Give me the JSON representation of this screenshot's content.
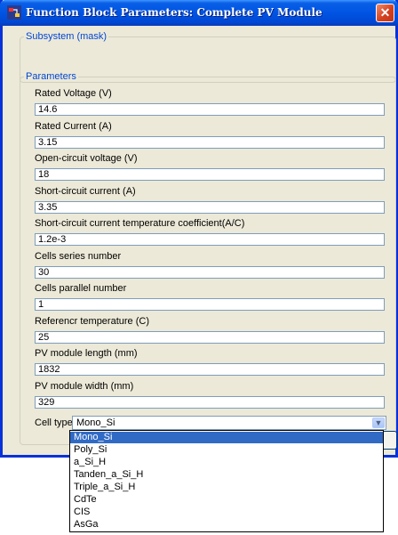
{
  "window": {
    "title": "Function Block Parameters: Complete PV Module",
    "close_glyph": "✕"
  },
  "mask_group": {
    "legend": "Subsystem (mask)"
  },
  "params_group": {
    "legend": "Parameters",
    "fields": [
      {
        "label": "Rated Voltage (V)",
        "value": "14.6"
      },
      {
        "label": "Rated Current (A)",
        "value": "3.15"
      },
      {
        "label": "Open-circuit voltage (V)",
        "value": "18"
      },
      {
        "label": "Short-circuit current (A)",
        "value": "3.35"
      },
      {
        "label": "Short-circuit current temperature coefficient(A/C)",
        "value": "1.2e-3"
      },
      {
        "label": "Cells series number",
        "value": "30"
      },
      {
        "label": "Cells parallel number",
        "value": "1"
      },
      {
        "label": "Referencr temperature (C)",
        "value": "25"
      },
      {
        "label": "PV module length (mm)",
        "value": "1832"
      },
      {
        "label": "PV module width (mm)",
        "value": "329"
      }
    ]
  },
  "cell_type": {
    "label": "Cell type",
    "value": "Mono_Si",
    "options": [
      "Mono_Si",
      "Poly_Si",
      "a_Si_H",
      "Tanden_a_Si_H",
      "Triple_a_Si_H",
      "CdTe",
      "CIS",
      "AsGa"
    ],
    "highlighted_index": 0
  },
  "colors": {
    "titlebar": "#0054e3",
    "window_bg": "#ece9d8",
    "legend": "#0046d5",
    "selection": "#316ac5"
  }
}
